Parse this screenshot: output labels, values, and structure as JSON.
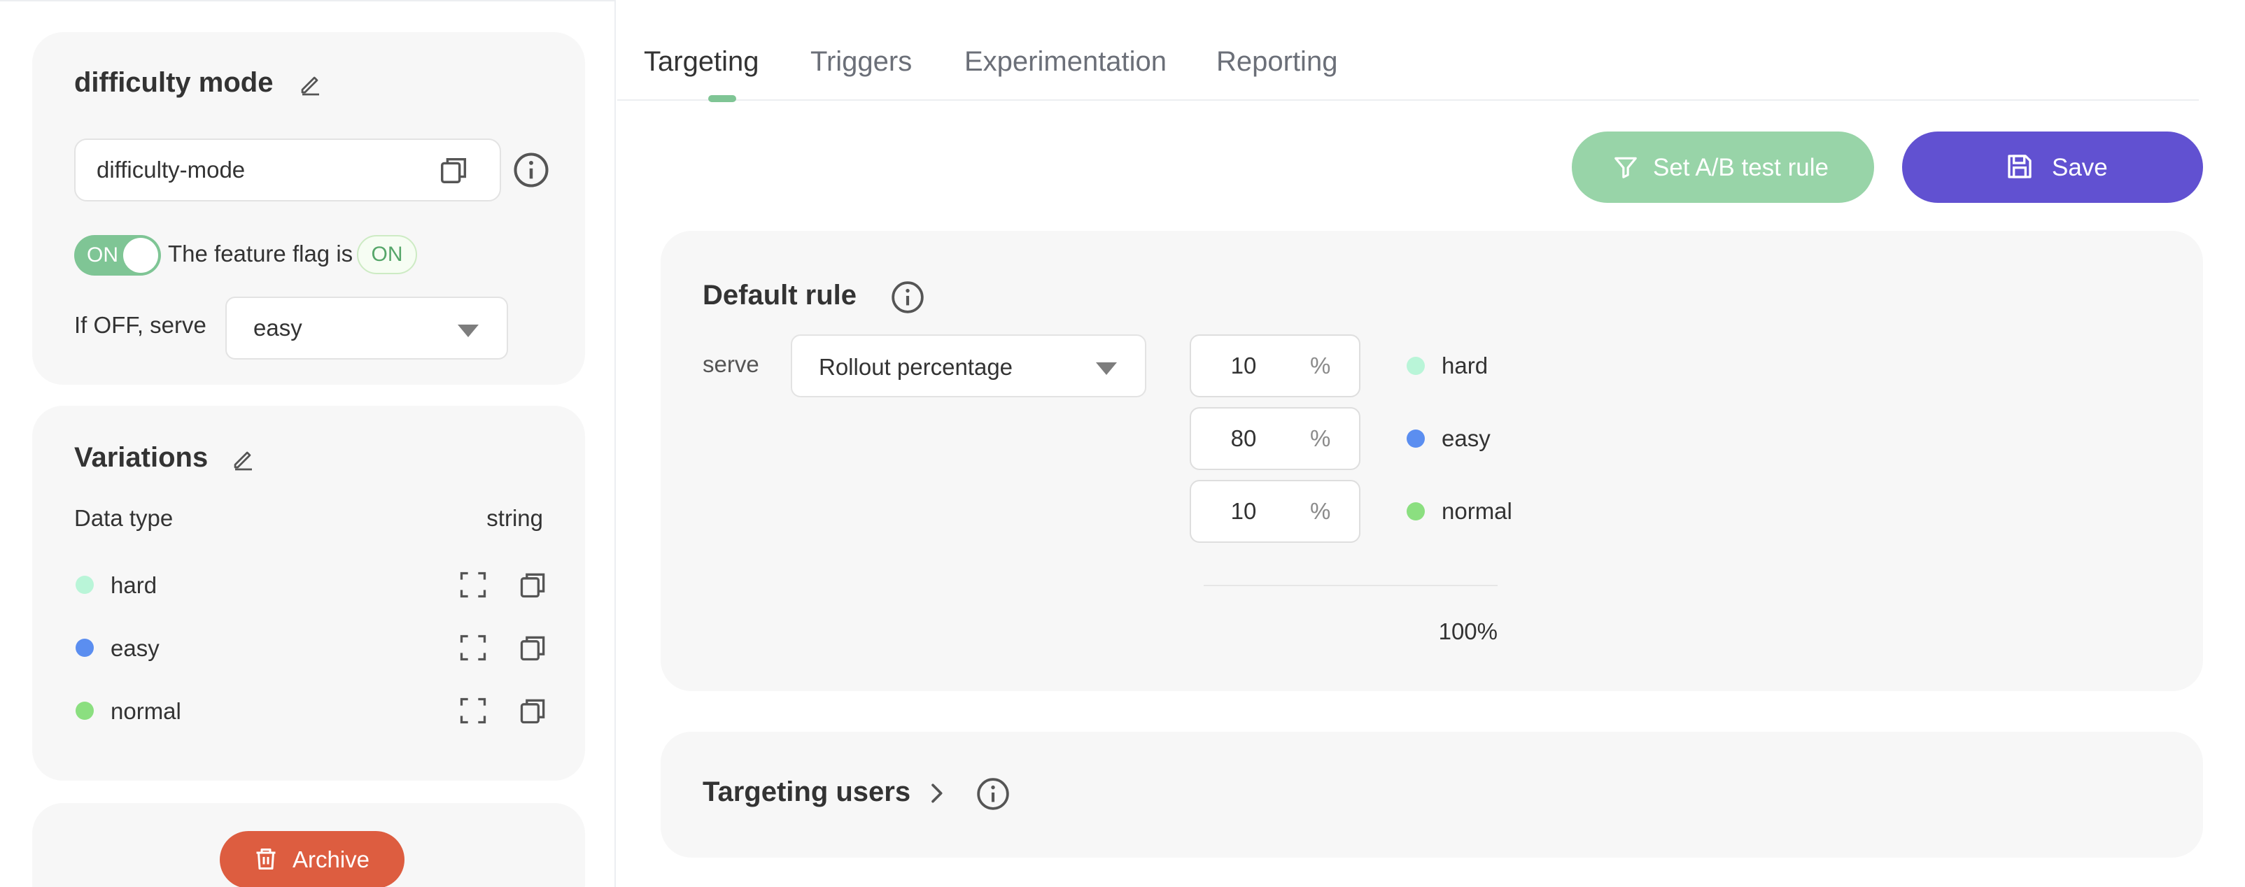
{
  "flag": {
    "title": "difficulty mode",
    "key": "difficulty-mode",
    "toggle_label": "ON",
    "status_text": "The feature flag is",
    "status_badge": "ON",
    "off_label": "If OFF, serve",
    "off_value": "easy"
  },
  "variations": {
    "title": "Variations",
    "data_type_label": "Data type",
    "data_type_value": "string",
    "items": [
      {
        "label": "hard",
        "color": "#b9f5d8"
      },
      {
        "label": "easy",
        "color": "#5b8ef0"
      },
      {
        "label": "normal",
        "color": "#8bdf80"
      }
    ]
  },
  "archive": {
    "label": "Archive"
  },
  "tabs": [
    {
      "label": "Targeting",
      "active": true
    },
    {
      "label": "Triggers"
    },
    {
      "label": "Experimentation"
    },
    {
      "label": "Reporting"
    }
  ],
  "toolbar": {
    "ab_label": "Set A/B test rule",
    "save_label": "Save"
  },
  "default_rule": {
    "title": "Default rule",
    "serve_label": "serve",
    "mode": "Rollout percentage",
    "unit": "%",
    "rows": [
      {
        "value": "10",
        "label": "hard"
      },
      {
        "value": "80",
        "label": "easy"
      },
      {
        "value": "10",
        "label": "normal"
      }
    ],
    "total": "100%"
  },
  "targeting_users": {
    "title": "Targeting users"
  },
  "colors": {
    "accent_green": "#7fc595",
    "save_purple": "#6151d1",
    "archive_red": "#dd5d40"
  }
}
